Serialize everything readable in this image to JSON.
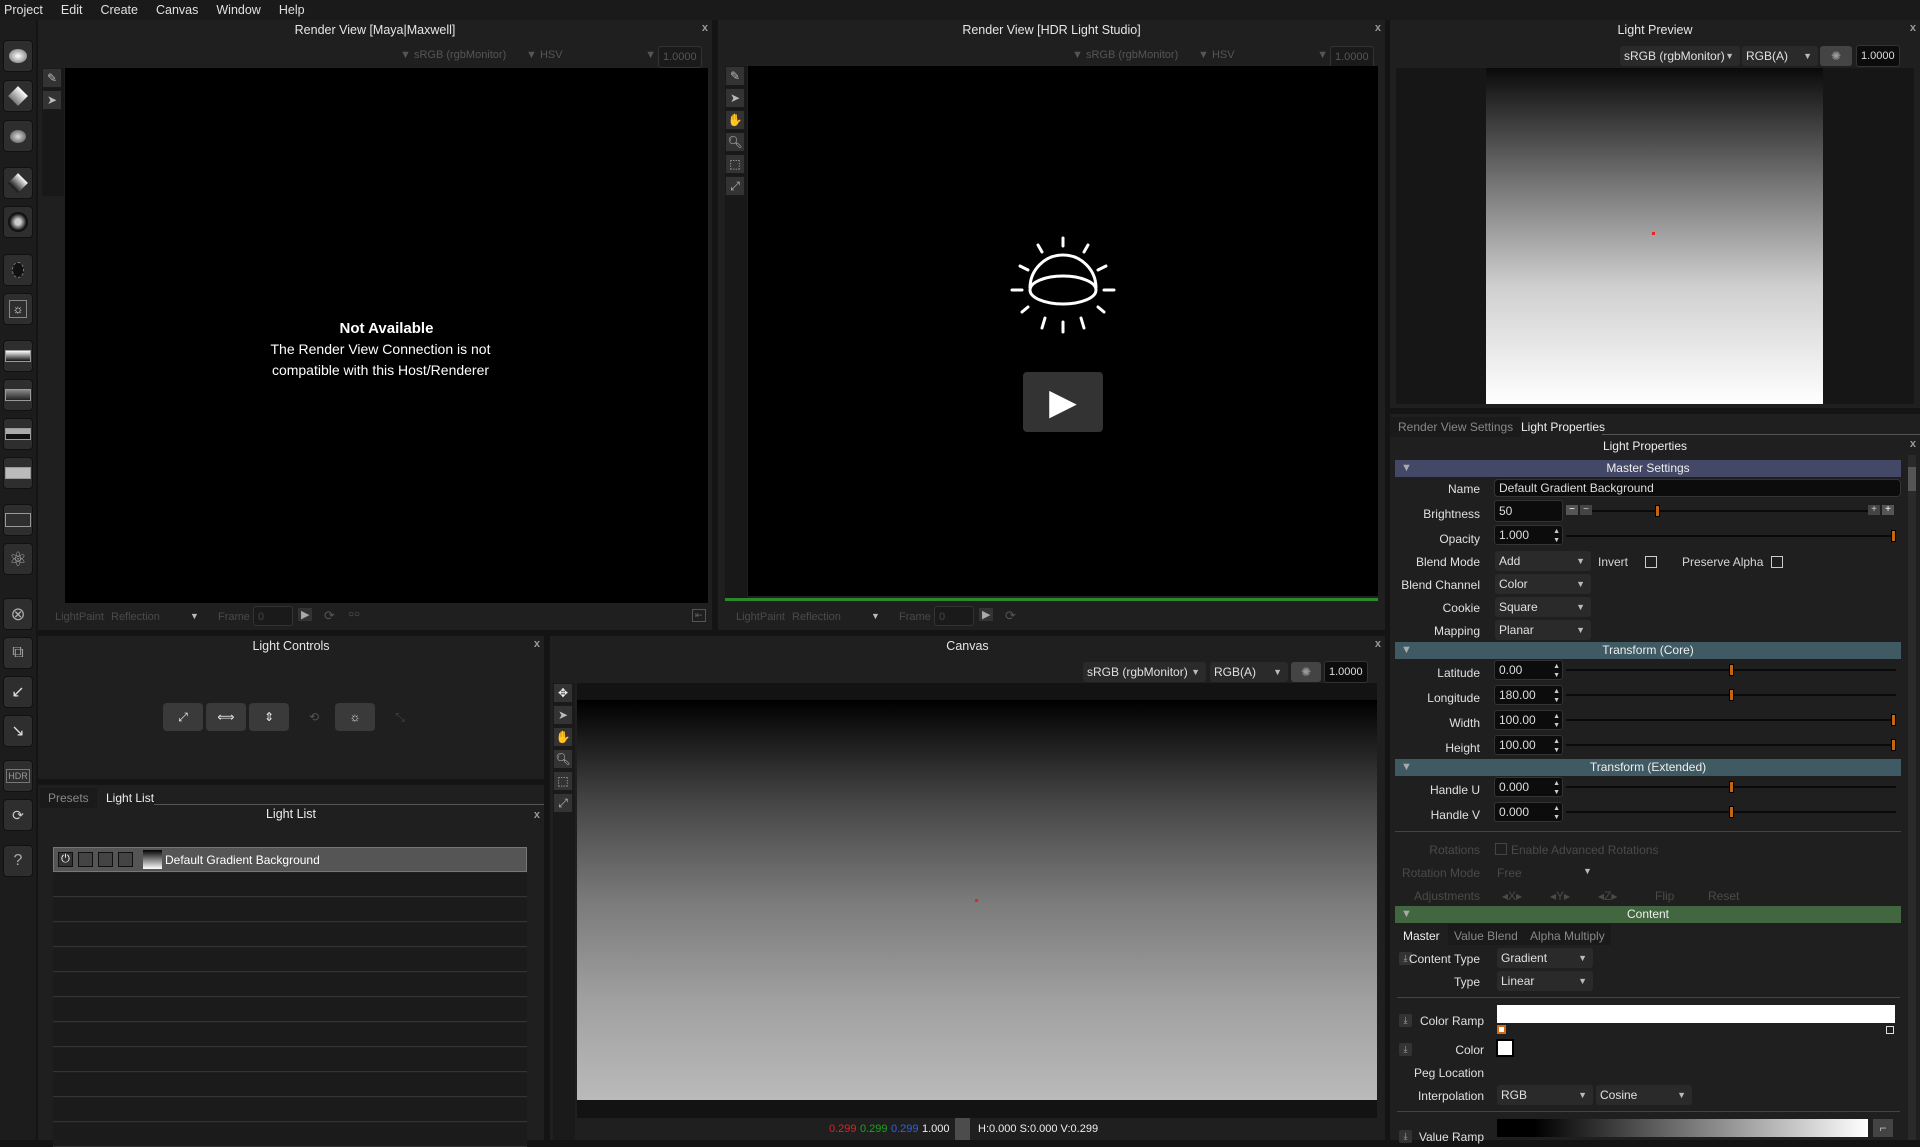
{
  "menu": [
    "Project",
    "Edit",
    "Create",
    "Canvas",
    "Window",
    "Help"
  ],
  "render_view_maya": {
    "title": "Render View [Maya|Maxwell]",
    "colorspace": "sRGB (rgbMonitor)",
    "channel": "HSV",
    "exposure": "1.0000",
    "message_title": "Not Available",
    "message_line1": "The Render View Connection is not",
    "message_line2": "compatible with this Host/Renderer",
    "footer_mode": "LightPaint",
    "footer_target": "Reflection",
    "footer_frame_label": "Frame",
    "footer_frame_value": "0"
  },
  "render_view_hdr": {
    "title": "Render View [HDR Light Studio]",
    "colorspace": "sRGB (rgbMonitor)",
    "channel": "HSV",
    "exposure": "1.0000",
    "footer_mode": "LightPaint",
    "footer_target": "Reflection",
    "footer_frame_label": "Frame",
    "footer_frame_value": "0"
  },
  "light_preview": {
    "title": "Light Preview",
    "colorspace": "sRGB (rgbMonitor)",
    "channel": "RGB(A)",
    "exposure": "1.0000"
  },
  "light_controls": {
    "title": "Light Controls"
  },
  "light_list_tabs": [
    "Presets",
    "Light List"
  ],
  "light_list": {
    "title": "Light List",
    "items": [
      "Default Gradient Background"
    ]
  },
  "canvas": {
    "title": "Canvas",
    "colorspace": "sRGB (rgbMonitor)",
    "channel": "RGB(A)",
    "exposure": "1.0000",
    "status_r": "0.299",
    "status_g": "0.299",
    "status_b": "0.299",
    "status_a": "1.000",
    "status_hsv": "H:0.000 S:0.000 V:0.299"
  },
  "props_tabs": [
    "Render View Settings",
    "Light Properties"
  ],
  "props": {
    "title": "Light Properties",
    "master_header": "Master Settings",
    "name_label": "Name",
    "name_value": "Default Gradient Background",
    "brightness_label": "Brightness",
    "brightness_value": "50",
    "opacity_label": "Opacity",
    "opacity_value": "1.000",
    "blend_mode_label": "Blend Mode",
    "blend_mode_value": "Add",
    "invert_label": "Invert",
    "preserve_alpha_label": "Preserve Alpha",
    "blend_channel_label": "Blend Channel",
    "blend_channel_value": "Color",
    "cookie_label": "Cookie",
    "cookie_value": "Square",
    "mapping_label": "Mapping",
    "mapping_value": "Planar",
    "transform_core_header": "Transform (Core)",
    "latitude_label": "Latitude",
    "latitude_value": "0.00",
    "longitude_label": "Longitude",
    "longitude_value": "180.00",
    "width_label": "Width",
    "width_value": "100.00",
    "height_label": "Height",
    "height_value": "100.00",
    "transform_ext_header": "Transform (Extended)",
    "handle_u_label": "Handle U",
    "handle_u_value": "0.000",
    "handle_v_label": "Handle V",
    "handle_v_value": "0.000",
    "rotations_label": "Rotations",
    "enable_adv_rot_label": "Enable Advanced Rotations",
    "rotation_mode_label": "Rotation Mode",
    "rotation_mode_value": "Free",
    "adjustments_label": "Adjustments",
    "adj_x": "X",
    "adj_y": "Y",
    "adj_z": "Z",
    "flip_label": "Flip",
    "reset_label": "Reset",
    "content_header": "Content",
    "content_tabs": [
      "Master",
      "Value Blend",
      "Alpha Multiply"
    ],
    "content_type_label": "Content Type",
    "content_type_value": "Gradient",
    "type_label": "Type",
    "type_value": "Linear",
    "color_ramp_label": "Color Ramp",
    "color_label": "Color",
    "peg_location_label": "Peg Location",
    "interpolation_label": "Interpolation",
    "interp_value1": "RGB",
    "interp_value2": "Cosine",
    "value_ramp_label": "Value Ramp"
  },
  "sliders": {
    "brightness": 0.23,
    "opacity": 1.0,
    "latitude": 0.5,
    "longitude": 0.5,
    "width": 1.0,
    "height": 1.0,
    "handle_u": 0.5,
    "handle_v": 0.5
  },
  "colors": {
    "accent_orange": "#c46514",
    "master_header": "#434866",
    "transform_header": "#3f5a63",
    "content_header": "#426640"
  }
}
